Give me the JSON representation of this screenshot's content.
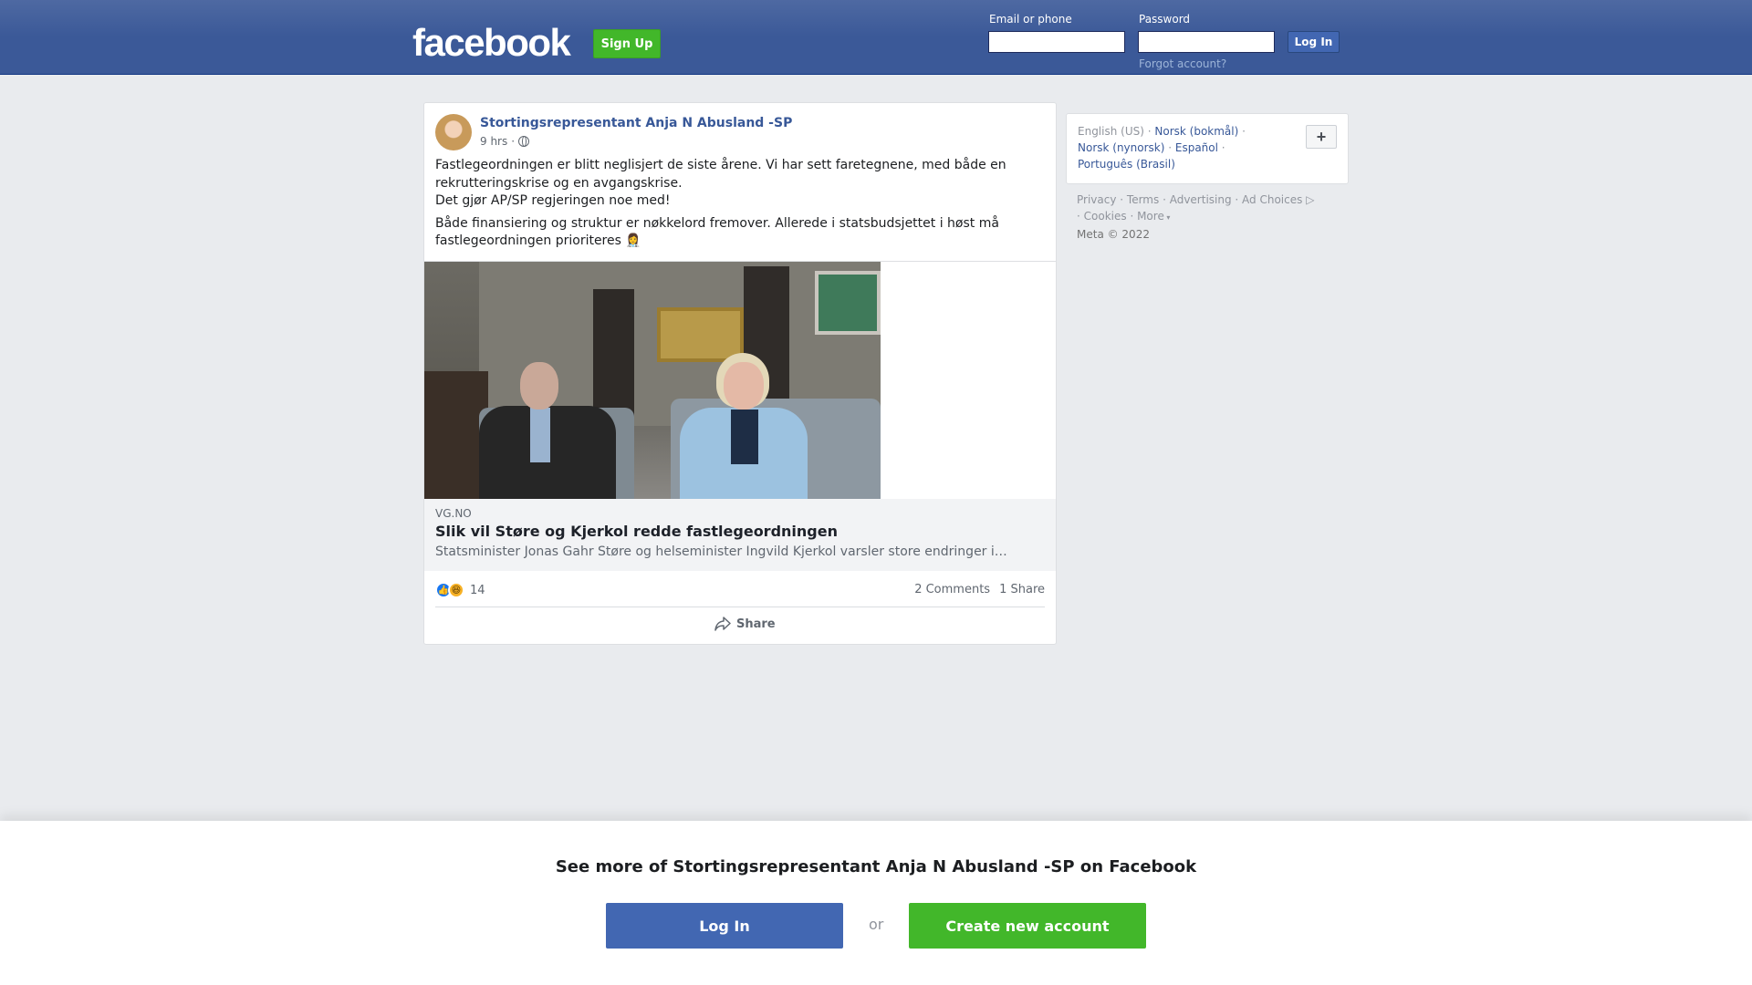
{
  "header": {
    "logo": "facebook",
    "signup_label": "Sign Up",
    "email_label": "Email or phone",
    "email_value": "",
    "password_label": "Password",
    "password_value": "",
    "login_label": "Log In",
    "forgot_label": "Forgot account?"
  },
  "post": {
    "author": "Stortingsrepresentant Anja N Abusland -SP",
    "time": "9 hrs",
    "privacy_icon": "globe-icon",
    "text_lines": [
      "Fastlegeordningen er blitt neglisjert de siste årene. Vi har sett faretegnene, med både en rekrutteringskrise og en avgangskrise.",
      "Det gjør AP/SP regjeringen noe med!",
      "Både finansiering og struktur er nøkkelord fremover. Allerede i statsbudsjettet i høst må fastlegeordningen prioriteres 👩‍⚕️"
    ],
    "link": {
      "domain": "VG.NO",
      "title": "Slik vil Støre og Kjerkol redde fastlegeordningen",
      "description": "Statsminister Jonas Gahr Støre og helseminister Ingvild Kjerkol varsler store endringer i…"
    },
    "reactions": {
      "icons": [
        "like-icon",
        "haha-icon"
      ],
      "count": "14"
    },
    "comments": "2 Comments",
    "shares": "1 Share",
    "share_label": "Share"
  },
  "sidebar": {
    "languages": {
      "current": "English (US)",
      "others": [
        "Norsk (bokmål)",
        "Norsk (nynorsk)",
        "Español",
        "Português (Brasil)"
      ]
    },
    "plus_label": "+",
    "footer_links": [
      "Privacy",
      "Terms",
      "Advertising",
      "Ad Choices",
      "Cookies",
      "More"
    ],
    "copyright": "Meta © 2022"
  },
  "banner": {
    "title": "See more of Stortingsrepresentant Anja N Abusland -SP on Facebook",
    "login_label": "Log In",
    "or_label": "or",
    "create_label": "Create new account"
  },
  "colors": {
    "brand_blue": "#3b5998",
    "button_blue": "#4267b2",
    "green": "#42b72a",
    "link": "#385898"
  }
}
